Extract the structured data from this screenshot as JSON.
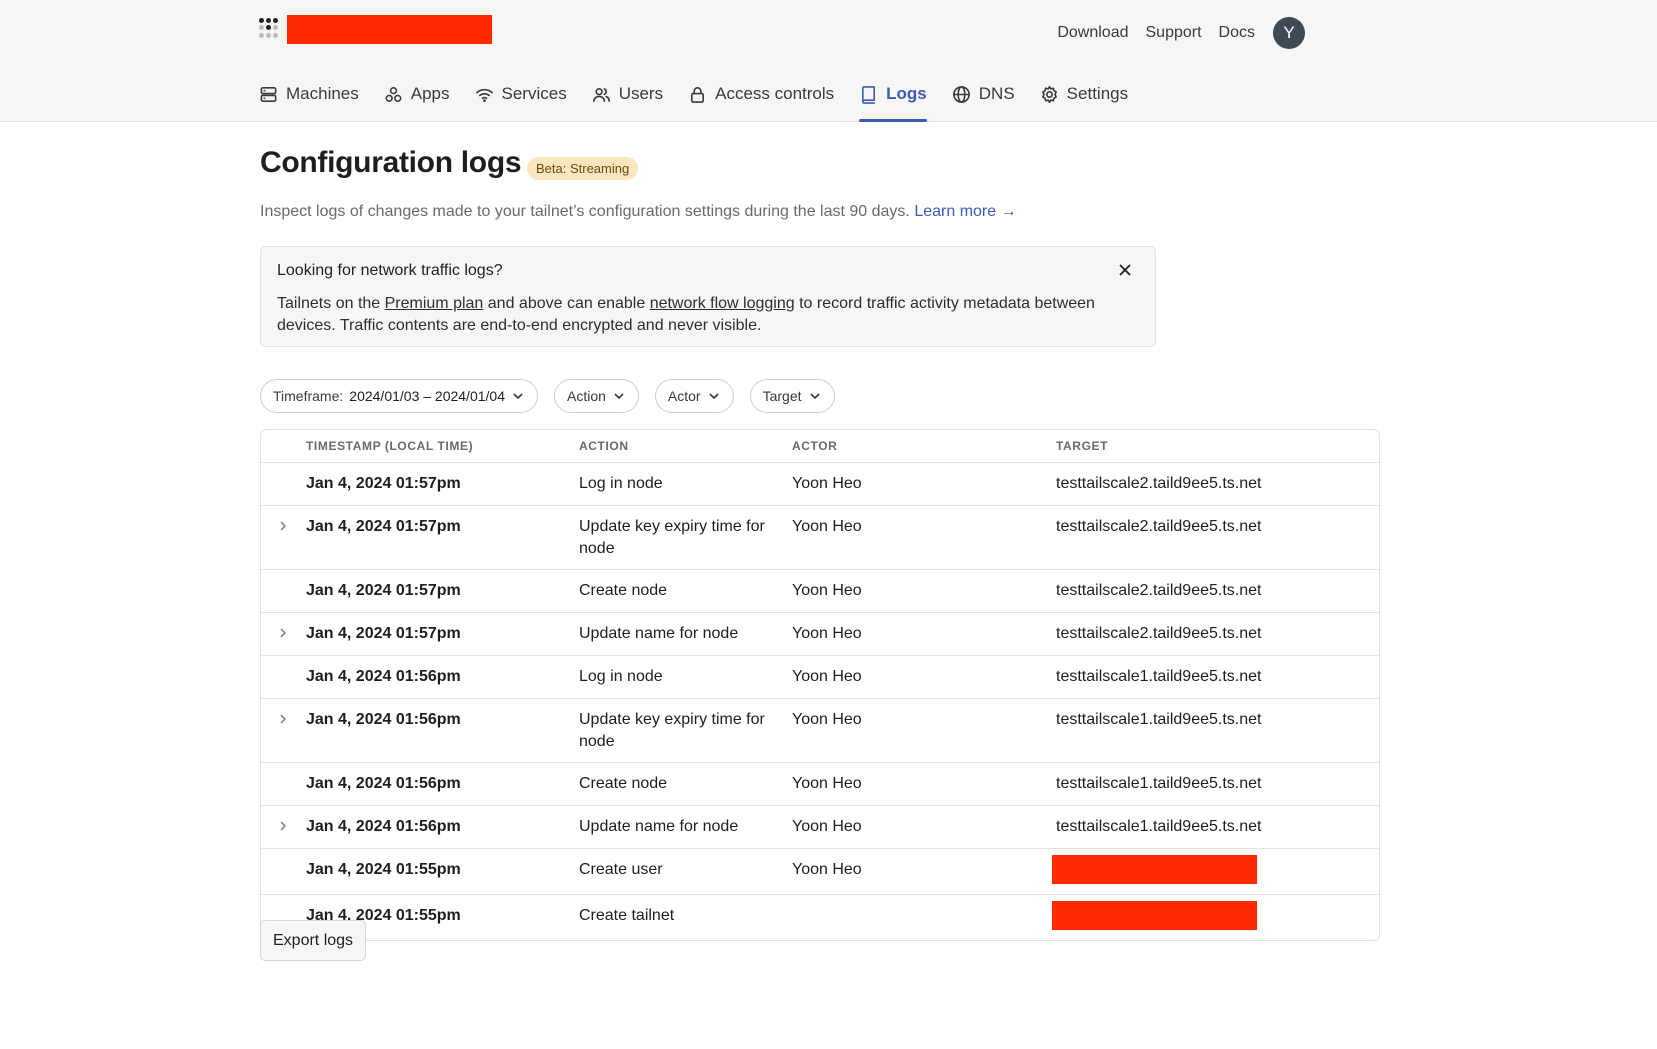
{
  "header": {
    "top_links": [
      "Download",
      "Support",
      "Docs"
    ],
    "avatar_initial": "Y"
  },
  "nav": {
    "items": [
      {
        "label": "Machines",
        "icon": "server-icon"
      },
      {
        "label": "Apps",
        "icon": "apps-icon"
      },
      {
        "label": "Services",
        "icon": "wifi-icon"
      },
      {
        "label": "Users",
        "icon": "users-icon"
      },
      {
        "label": "Access controls",
        "icon": "lock-icon"
      },
      {
        "label": "Logs",
        "icon": "book-icon",
        "active": true
      },
      {
        "label": "DNS",
        "icon": "globe-icon"
      },
      {
        "label": "Settings",
        "icon": "gear-icon"
      }
    ]
  },
  "page": {
    "title": "Configuration logs",
    "badge": "Beta: Streaming",
    "subtitle": "Inspect logs of changes made to your tailnet’s configuration settings during the last 90 days.",
    "learn_more": "Learn more →"
  },
  "notice": {
    "title": "Looking for network traffic logs?",
    "body_1": "Tailnets on the ",
    "link_1": "Premium plan",
    "body_2": " and above can enable ",
    "link_2": "network flow logging",
    "body_3": " to record traffic activity metadata between devices. Traffic contents are end-to-end encrypted and never visible."
  },
  "filters": {
    "timeframe_label": "Timeframe:",
    "timeframe_value": "2024/01/03 – 2024/01/04",
    "action": "Action",
    "actor": "Actor",
    "target": "Target"
  },
  "table": {
    "columns": [
      "TIMESTAMP (LOCAL TIME)",
      "ACTION",
      "ACTOR",
      "TARGET"
    ],
    "rows": [
      {
        "ts": "Jan 4, 2024 01:57pm",
        "action": "Log in node",
        "actor": "Yoon Heo",
        "target": "testtailscale2.taild9ee5.ts.net",
        "expandable": false
      },
      {
        "ts": "Jan 4, 2024 01:57pm",
        "action": "Update key expiry time for node",
        "actor": "Yoon Heo",
        "target": "testtailscale2.taild9ee5.ts.net",
        "expandable": true
      },
      {
        "ts": "Jan 4, 2024 01:57pm",
        "action": "Create node",
        "actor": "Yoon Heo",
        "target": "testtailscale2.taild9ee5.ts.net",
        "expandable": false
      },
      {
        "ts": "Jan 4, 2024 01:57pm",
        "action": "Update name for node",
        "actor": "Yoon Heo",
        "target": "testtailscale2.taild9ee5.ts.net",
        "expandable": true
      },
      {
        "ts": "Jan 4, 2024 01:56pm",
        "action": "Log in node",
        "actor": "Yoon Heo",
        "target": "testtailscale1.taild9ee5.ts.net",
        "expandable": false
      },
      {
        "ts": "Jan 4, 2024 01:56pm",
        "action": "Update key expiry time for node",
        "actor": "Yoon Heo",
        "target": "testtailscale1.taild9ee5.ts.net",
        "expandable": true
      },
      {
        "ts": "Jan 4, 2024 01:56pm",
        "action": "Create node",
        "actor": "Yoon Heo",
        "target": "testtailscale1.taild9ee5.ts.net",
        "expandable": false
      },
      {
        "ts": "Jan 4, 2024 01:56pm",
        "action": "Update name for node",
        "actor": "Yoon Heo",
        "target": "testtailscale1.taild9ee5.ts.net",
        "expandable": true
      },
      {
        "ts": "Jan 4, 2024 01:55pm",
        "action": "Create user",
        "actor": "Yoon Heo",
        "target": "",
        "expandable": false,
        "redacted": true
      },
      {
        "ts": "Jan 4, 2024 01:55pm",
        "action": "Create tailnet",
        "actor": "",
        "target": "",
        "expandable": false,
        "redacted": true
      }
    ]
  },
  "export_label": "Export logs",
  "colors": {
    "accent": "#3b5bb5",
    "redaction": "#ff2a00",
    "badge_bg": "#fbe6c0"
  }
}
